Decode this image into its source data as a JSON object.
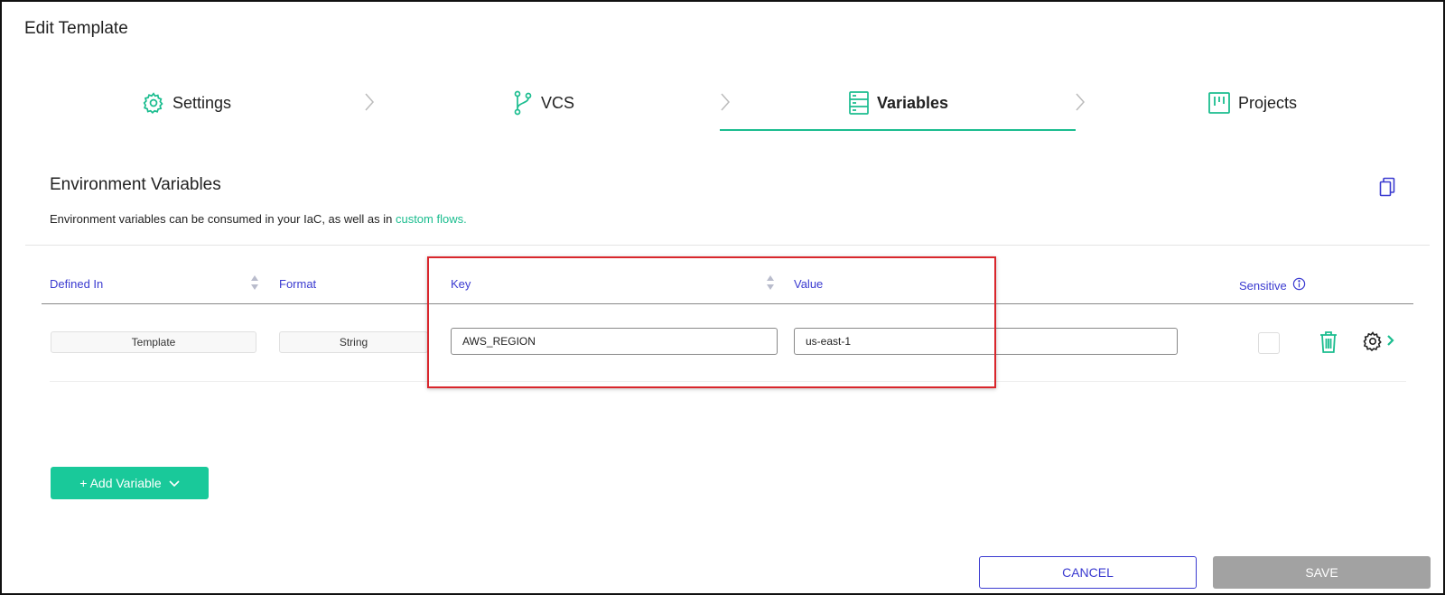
{
  "page": {
    "title": "Edit Template"
  },
  "stepper": {
    "steps": [
      {
        "label": "Settings",
        "icon": "gear-icon"
      },
      {
        "label": "VCS",
        "icon": "git-branch-icon"
      },
      {
        "label": "Variables",
        "icon": "server-stack-icon",
        "active": true
      },
      {
        "label": "Projects",
        "icon": "kanban-board-icon"
      }
    ]
  },
  "section": {
    "title": "Environment Variables",
    "description": "Environment variables can be consumed in your IaC, as well as in ",
    "link_text": "custom flows."
  },
  "table": {
    "headers": {
      "defined_in": "Defined In",
      "format": "Format",
      "key": "Key",
      "value": "Value",
      "sensitive": "Sensitive"
    },
    "rows": [
      {
        "defined_in": "Template",
        "format": "String",
        "key": "AWS_REGION",
        "value": "us-east-1",
        "sensitive": false
      }
    ]
  },
  "actions": {
    "add_variable": "+ Add Variable",
    "cancel": "CANCEL",
    "save": "SAVE"
  },
  "colors": {
    "accent": "#1bbd8f",
    "link_blue": "#3a3ad0",
    "highlight": "#d9262c",
    "disabled": "#a2a2a2"
  }
}
